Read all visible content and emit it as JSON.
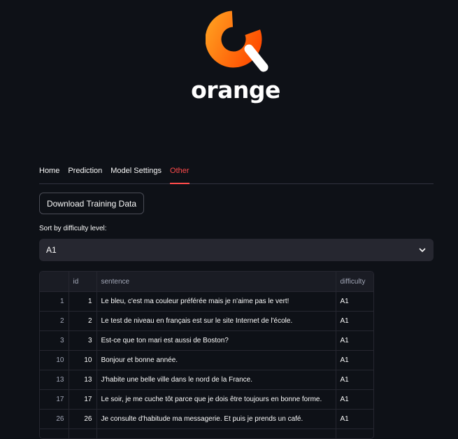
{
  "brand": {
    "name": "orange",
    "accent_color": "#ff4b4b",
    "logo_gradient": [
      "#ff9a1e",
      "#ff4a00"
    ]
  },
  "tabs": [
    {
      "label": "Home",
      "active": false
    },
    {
      "label": "Prediction",
      "active": false
    },
    {
      "label": "Model Settings",
      "active": false
    },
    {
      "label": "Other",
      "active": true
    }
  ],
  "download_button": {
    "label": "Download Training Data"
  },
  "sort": {
    "label": "Sort by difficulty level:",
    "selected": "A1",
    "icon": "chevron-down-icon"
  },
  "table": {
    "columns": [
      "",
      "id",
      "sentence",
      "difficulty"
    ],
    "rows": [
      {
        "index": "1",
        "id": "1",
        "sentence": "Le bleu, c'est ma couleur préférée mais je n'aime pas le vert!",
        "difficulty": "A1"
      },
      {
        "index": "2",
        "id": "2",
        "sentence": "Le test de niveau en français est sur le site Internet de l'école.",
        "difficulty": "A1"
      },
      {
        "index": "3",
        "id": "3",
        "sentence": "Est-ce que ton mari est aussi de Boston?",
        "difficulty": "A1"
      },
      {
        "index": "10",
        "id": "10",
        "sentence": "Bonjour et bonne année.",
        "difficulty": "A1"
      },
      {
        "index": "13",
        "id": "13",
        "sentence": "J'habite une belle ville dans le nord de la France.",
        "difficulty": "A1"
      },
      {
        "index": "17",
        "id": "17",
        "sentence": "Le soir, je me cuche tôt parce que je dois être toujours en bonne forme.",
        "difficulty": "A1"
      },
      {
        "index": "26",
        "id": "26",
        "sentence": "Je consulte d'habitude ma messagerie. Et puis je prends un café.",
        "difficulty": "A1"
      },
      {
        "index": "",
        "id": "",
        "sentence": "",
        "difficulty": ""
      }
    ]
  }
}
